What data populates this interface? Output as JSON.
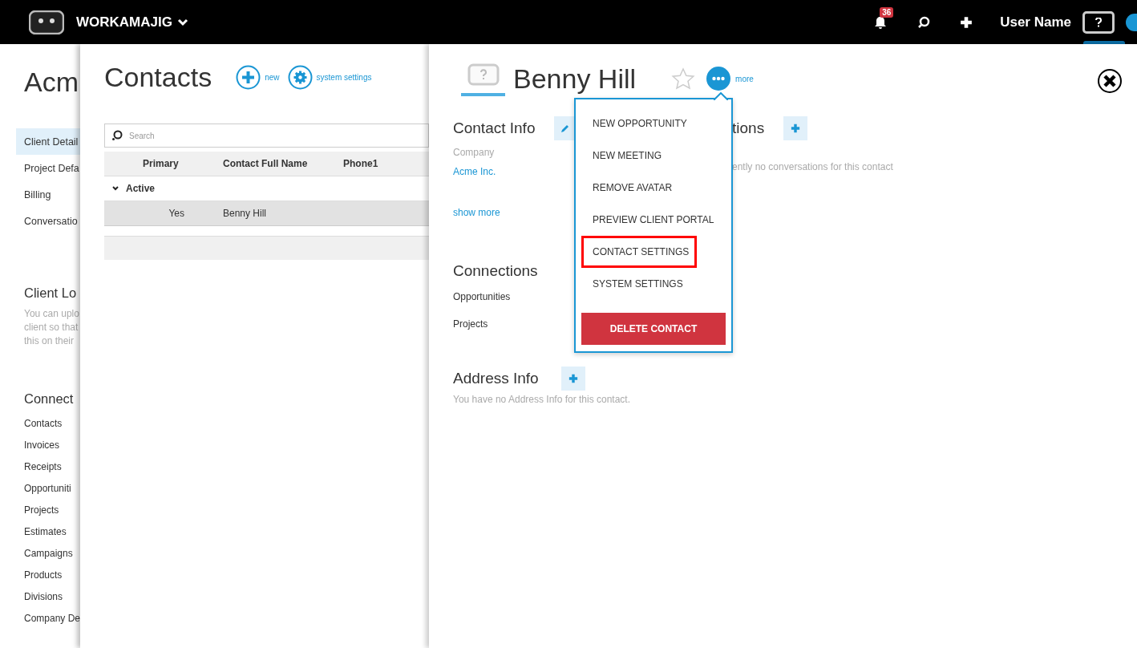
{
  "top_bar": {
    "app_name": "WORKAMAJIG",
    "notification_count": "36",
    "user_name": "User Name"
  },
  "client_page": {
    "title": "Acm",
    "nav": [
      {
        "label": "Client Detail",
        "selected": true
      },
      {
        "label": "Project Defa",
        "selected": false
      },
      {
        "label": "Billing",
        "selected": false
      },
      {
        "label": "Conversatio",
        "selected": false
      }
    ],
    "logo_section": {
      "title": "Client Lo",
      "lines": [
        "You can uplo",
        "client so that",
        "this on their"
      ]
    },
    "connections": {
      "title": "Connect",
      "items": [
        "Contacts",
        "Invoices",
        "Receipts",
        "Opportuniti",
        "Projects",
        "Estimates",
        "Campaigns",
        "Products",
        "Divisions",
        "Company De"
      ]
    }
  },
  "contacts_panel": {
    "title": "Contacts",
    "actions": [
      {
        "kind": "add",
        "label": "new"
      },
      {
        "kind": "settings",
        "label": "system settings"
      }
    ],
    "search": {
      "placeholder": "Search"
    },
    "table": {
      "columns": [
        "Primary",
        "Contact Full Name",
        "Phone1"
      ],
      "groups": [
        {
          "label": "Active",
          "expanded": true,
          "rows": [
            {
              "primary": "Yes",
              "name": "Benny Hill",
              "selected": true
            }
          ]
        }
      ]
    }
  },
  "contact": {
    "name": "Benny Hill",
    "starred": false,
    "more_label": "more",
    "contact_info": {
      "title": "Contact Info",
      "fields": [
        {
          "label": "Company",
          "value": "Acme Inc."
        }
      ],
      "show_more": "show more"
    },
    "conversations": {
      "title": "tions",
      "empty_text": "ently no conversations for this contact"
    },
    "connections": {
      "title": "Connections",
      "items": [
        "Opportunities",
        "Projects"
      ]
    },
    "address_info": {
      "title": "Address Info",
      "empty_text": "You have no Address Info for this contact."
    }
  },
  "more_menu": {
    "items": [
      {
        "label": "NEW OPPORTUNITY",
        "highlighted": false
      },
      {
        "label": "NEW MEETING",
        "highlighted": false
      },
      {
        "label": "REMOVE AVATAR",
        "highlighted": false
      },
      {
        "label": "PREVIEW CLIENT PORTAL",
        "highlighted": false
      },
      {
        "label": "CONTACT SETTINGS",
        "highlighted": true
      },
      {
        "label": "SYSTEM SETTINGS",
        "highlighted": false
      }
    ],
    "danger_button": "DELETE CONTACT"
  }
}
